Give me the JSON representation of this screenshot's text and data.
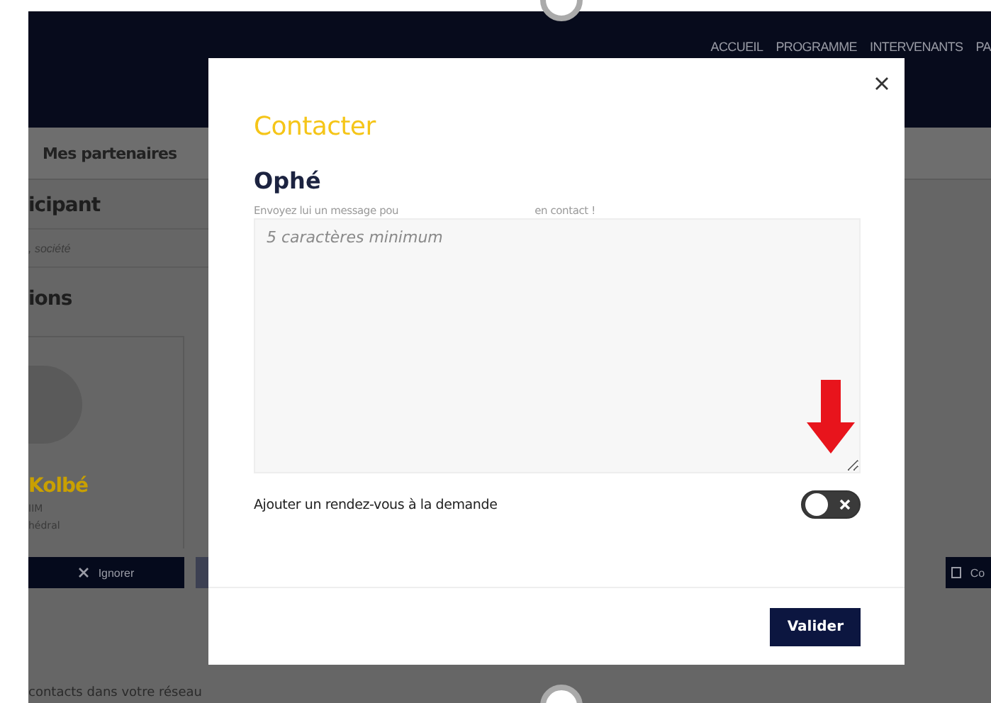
{
  "navbar": {
    "links": [
      "ACCUEIL",
      "PROGRAMME",
      "INTERVENANTS",
      "PA"
    ]
  },
  "subnav": {
    "tab": "Mes partenaires"
  },
  "page": {
    "heading": "icipant",
    "search_placeholder": ", société",
    "section": "ions",
    "card": {
      "name": "Kolbé",
      "line_1": "IIM",
      "line_2": "hédral"
    },
    "buttons": [
      {
        "label": "Ignorer",
        "kind": "ignore"
      },
      {
        "kind": "blank"
      },
      {
        "label": "Co",
        "kind": "contact"
      }
    ],
    "footer_text": "contacts dans votre réseau"
  },
  "dialog": {
    "title": "Contacter",
    "recipient": "Ophé",
    "hint_start": "Envoyez lui un message pou",
    "hint_end": "en contact !",
    "message": {
      "placeholder": "5 caractères minimum"
    },
    "appointment_toggle": {
      "label": "Ajouter un rendez-vous à la demande",
      "on": false
    },
    "submit": "Valider"
  }
}
